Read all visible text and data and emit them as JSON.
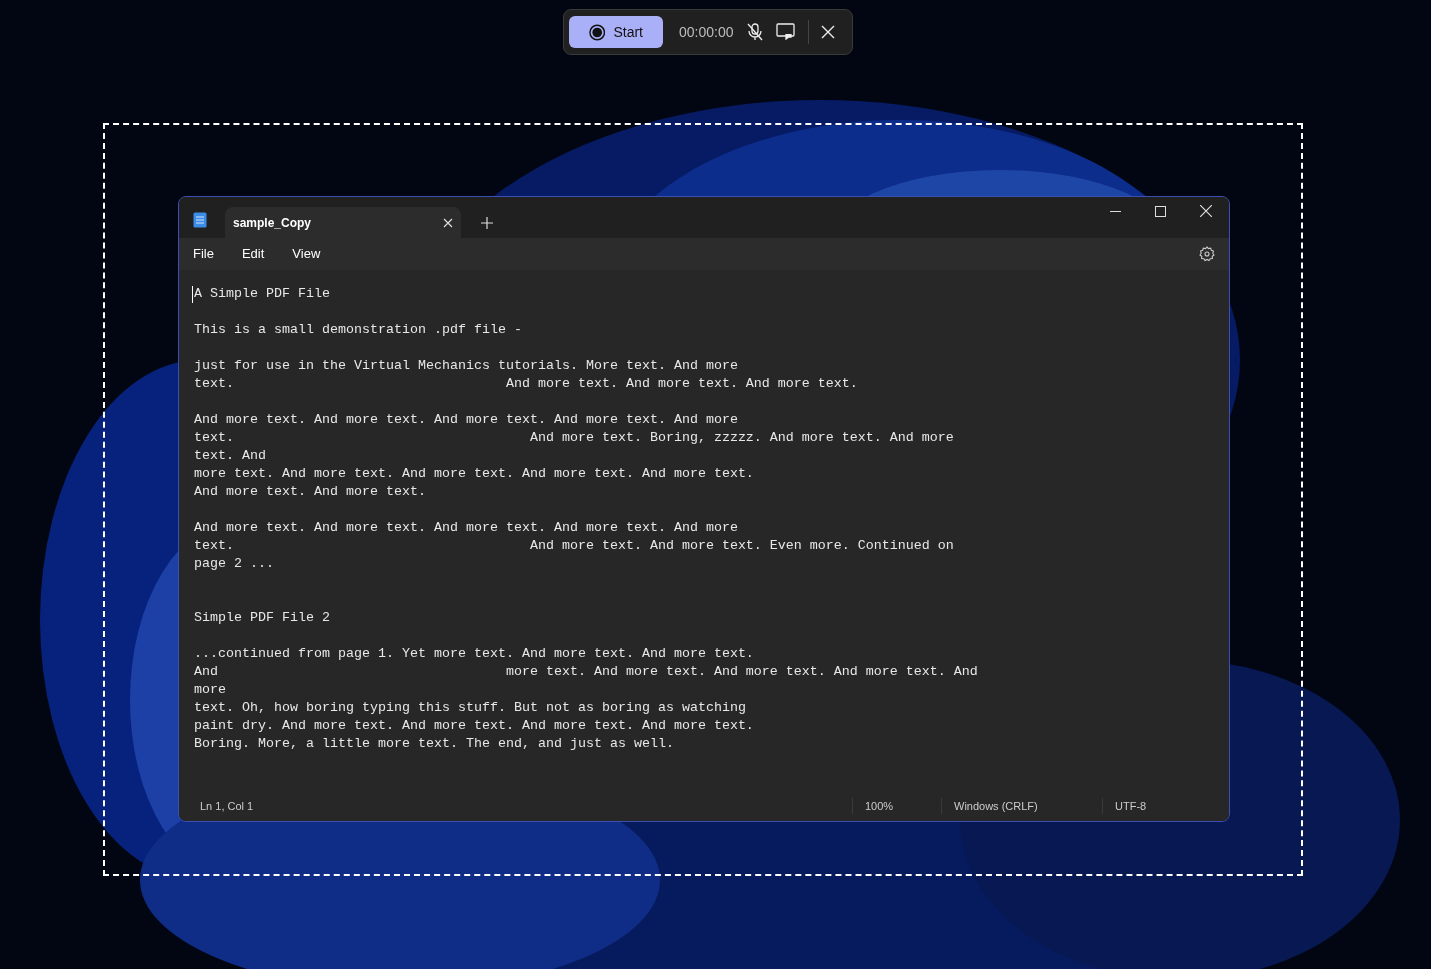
{
  "recorder": {
    "start_button": "Start",
    "timer": "00:00:00",
    "mic_muted": true
  },
  "window": {
    "tabs": [
      {
        "label": "sample_Copy",
        "selected": true
      }
    ],
    "menu": [
      "File",
      "Edit",
      "View"
    ],
    "pages": [
      {
        "paragraphs": [
          [
            "A Simple PDF File"
          ],
          [
            "This is a small demonstration .pdf file -"
          ],
          [
            "just for use in the Virtual Mechanics tutorials. More text. And more",
            "text.                                  And more text. And more text. And more text."
          ],
          [
            "And more text. And more text. And more text. And more text. And more",
            "text.                                     And more text. Boring, zzzzz. And more text. And more",
            "text. And",
            "more text. And more text. And more text. And more text. And more text.",
            "And more text. And more text."
          ],
          [
            "And more text. And more text. And more text. And more text. And more",
            "text.                                     And more text. And more text. Even more. Continued on",
            "page 2 ..."
          ]
        ]
      },
      {
        "paragraphs": [
          [
            "Simple PDF File 2"
          ],
          [
            "...continued from page 1. Yet more text. And more text. And more text.",
            "And                                    more text. And more text. And more text. And more text. And",
            "more",
            "text. Oh, how boring typing this stuff. But not as boring as watching",
            "paint dry. And more text. And more text. And more text. And more text.",
            "Boring. More, a little more text. The end, and just as well."
          ]
        ]
      }
    ],
    "status_bar": {
      "position": "Ln 1, Col 1",
      "zoom": "100%",
      "line_ending": "Windows (CRLF)",
      "encoding": "UTF-8"
    }
  }
}
